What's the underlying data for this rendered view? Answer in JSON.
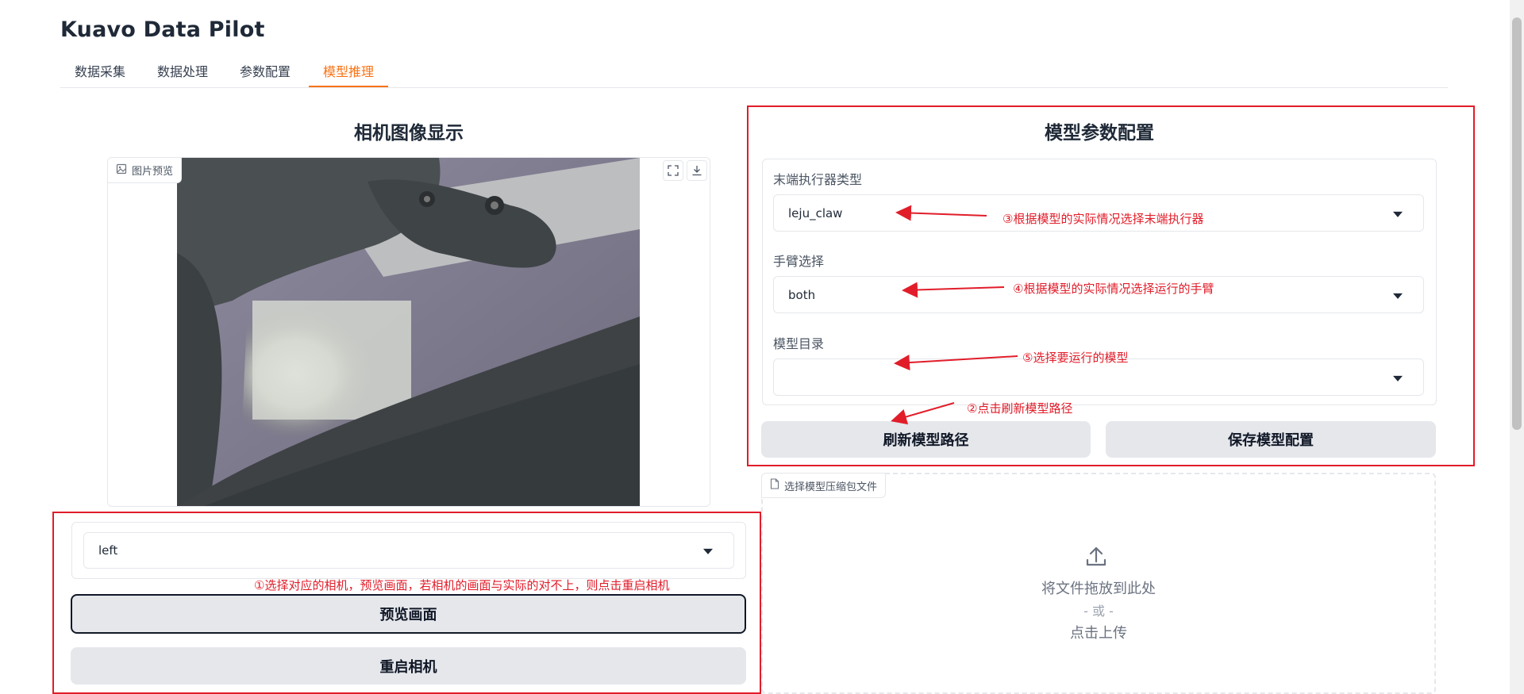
{
  "app": {
    "title": "Kuavo Data Pilot"
  },
  "tabs": [
    {
      "label": "数据采集"
    },
    {
      "label": "数据处理"
    },
    {
      "label": "参数配置"
    },
    {
      "label": "模型推理",
      "active": true
    }
  ],
  "camera": {
    "section_title": "相机图像显示",
    "image_label": "图片预览",
    "selected_camera": "left",
    "preview_button": "预览画面",
    "restart_button": "重启相机"
  },
  "model": {
    "section_title": "模型参数配置",
    "end_effector_label": "末端执行器类型",
    "end_effector_value": "leju_claw",
    "arm_label": "手臂选择",
    "arm_value": "both",
    "model_dir_label": "模型目录",
    "model_dir_value": "",
    "refresh_button": "刷新模型路径",
    "save_button": "保存模型配置"
  },
  "upload": {
    "label": "选择模型压缩包文件",
    "drop_text": "将文件拖放到此处",
    "or_text": "- 或 -",
    "click_text": "点击上传"
  },
  "annotations": {
    "step1": "①选择对应的相机，预览画面，若相机的画面与实际的对不上，则点击重启相机",
    "step2": "②点击刷新模型路径",
    "step3": "③根据模型的实际情况选择末端执行器",
    "step4": "④根据模型的实际情况选择运行的手臂",
    "step5": "⑤选择要运行的模型"
  },
  "colors": {
    "accent": "#f97316",
    "annotation": "#e11d2a",
    "button_bg": "#e5e7eb"
  },
  "icons": [
    "image-icon",
    "fullscreen-icon",
    "download-icon",
    "file-icon",
    "upload-icon",
    "chevron-down-icon"
  ]
}
